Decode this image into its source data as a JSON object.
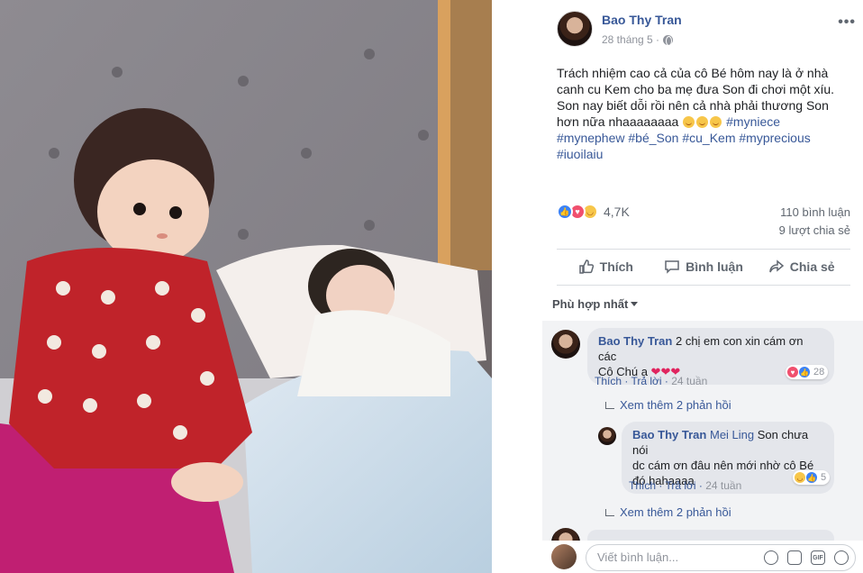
{
  "post": {
    "author": "Bao Thy Tran",
    "date": "28 tháng 5 ·",
    "text_lines": [
      "Trách nhiệm cao cả của cô Bé hôm nay là ở nhà",
      "canh cu Kem cho ba mẹ đưa Son đi chơi một xíu.",
      "Son nay biết dỗi rồi nên cả nhà phải thương Son",
      "hơn nữa nhaaaaaaaa"
    ],
    "hashtags": [
      "#myniece",
      "#mynephew",
      "#bé_Son",
      "#cu_Kem",
      "#myprecious",
      "#iuoilaiu"
    ],
    "reaction_count": "4,7K",
    "comment_count": "110 bình luận",
    "share_count": "9 lượt chia sẻ"
  },
  "actions": {
    "like": "Thích",
    "comment": "Bình luận",
    "share": "Chia sẻ"
  },
  "sort_label": "Phù hợp nhất",
  "comments": [
    {
      "author": "Bao Thy Tran",
      "text_line1": "2 chị em con xin cám ơn các",
      "text_line2": "Cô Chú ạ",
      "like": "Thích",
      "reply": "Trả lời",
      "time": "24 tuần",
      "reaction_count": "28",
      "more_replies": "Xem thêm 2 phản hồi"
    },
    {
      "author": "Bao Thy Tran",
      "mention": "Mei Ling",
      "text_line1": "Son chưa nói",
      "text_line2": "dc cám ơn đâu nên mới nhờ cô Bé",
      "text_line3": "đó hahaaaa",
      "like": "Thích",
      "reply": "Trả lời",
      "time": "24 tuần",
      "reaction_count": "5",
      "more_replies": "Xem thêm 2 phản hồi"
    }
  ],
  "write_placeholder": "Viết bình luận...",
  "icons": [
    "more-icon",
    "globe-icon",
    "like-icon",
    "comment-icon",
    "share-icon",
    "emoji-icon",
    "camera-icon",
    "gif-icon",
    "sticker-icon"
  ],
  "colors": {
    "link": "#385898",
    "like_blue": "#3b82f6",
    "love_red": "#f0506e",
    "haha_yellow": "#f7c64a"
  }
}
